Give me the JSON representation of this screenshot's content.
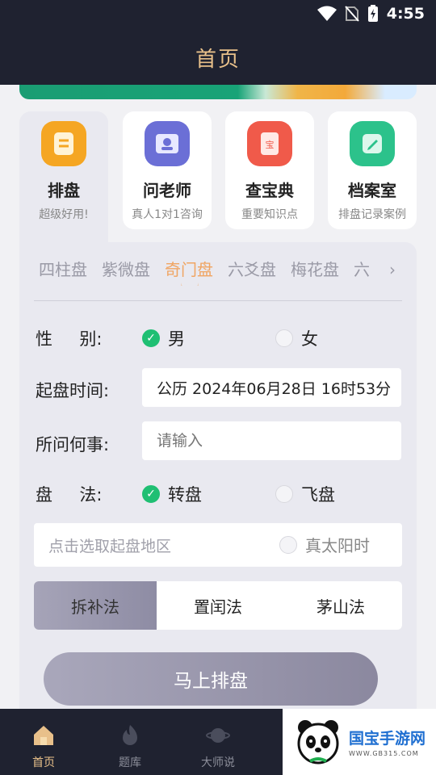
{
  "status": {
    "time": "4:55"
  },
  "app": {
    "title": "首页"
  },
  "quick": [
    {
      "title": "排盘",
      "subtitle": "超级好用!",
      "color": "#f5a623",
      "icon": "document-icon"
    },
    {
      "title": "问老师",
      "subtitle": "真人1对1咨询",
      "color": "#6b6fd6",
      "icon": "teacher-card-icon"
    },
    {
      "title": "查宝典",
      "subtitle": "重要知识点",
      "color": "#f05a4a",
      "icon": "treasure-book-icon"
    },
    {
      "title": "档案室",
      "subtitle": "排盘记录案例",
      "color": "#2cc28b",
      "icon": "edit-note-icon"
    }
  ],
  "tabs": [
    "四柱盘",
    "紫微盘",
    "奇门盘",
    "六爻盘",
    "梅花盘",
    "六"
  ],
  "form": {
    "gender_label": "性     别:",
    "gender_male": "男",
    "gender_female": "女",
    "time_label": "起盘时间:",
    "time_value": "公历 2024年06月28日 16时53分",
    "question_label": "所问何事:",
    "question_placeholder": "请输入",
    "method_label": "盘     法:",
    "method_zhuan": "转盘",
    "method_fei": "飞盘",
    "location_placeholder": "点击选取起盘地区",
    "true_solar": "真太阳时"
  },
  "segments": [
    "拆补法",
    "置闰法",
    "茅山法"
  ],
  "submit": "马上排盘",
  "nav": [
    {
      "label": "首页",
      "icon": "home-icon"
    },
    {
      "label": "题库",
      "icon": "flame-icon"
    },
    {
      "label": "大师说",
      "icon": "planet-icon"
    }
  ],
  "watermark": {
    "title": "国宝手游网",
    "url": "WWW.GB315.COM"
  },
  "colors": {
    "accent": "#e8c08a",
    "check": "#1fbf73",
    "tab_active": "#f0a563",
    "dark": "#1f2230"
  }
}
